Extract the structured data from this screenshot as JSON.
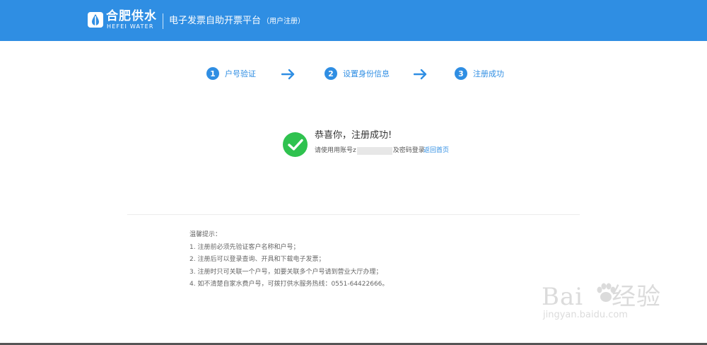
{
  "header": {
    "logo_cn": "合肥供水",
    "logo_en": "HEFEI WATER",
    "platform_title": "电子发票自助开票平台",
    "platform_subtitle": "（用户注册）",
    "brand_color": "#2f8ee3"
  },
  "steps": [
    {
      "num": "1",
      "label": "户号验证"
    },
    {
      "num": "2",
      "label": "设置身份信息"
    },
    {
      "num": "3",
      "label": "注册成功"
    }
  ],
  "result": {
    "title": "恭喜你，注册成功!",
    "desc_prefix": "请使用用账号z",
    "desc_suffix": "及密码登录",
    "back_link": "返回首页",
    "success_color": "#2fc24f",
    "icon": "check-icon"
  },
  "tips": {
    "heading": "温馨提示：",
    "items": [
      "1. 注册前必须先验证客户名称和户号；",
      "2. 注册后可以登录查询、开具和下载电子发票；",
      "3. 注册时只可关联一个户号，如要关联多个户号请到营业大厅办理；",
      "4. 如不清楚自家水费户号，可拨打供水服务热线：0551-64422666。"
    ]
  },
  "watermark": {
    "brand_left": "Bai",
    "brand_right": "经验",
    "url": "jingyan.baidu.com"
  }
}
